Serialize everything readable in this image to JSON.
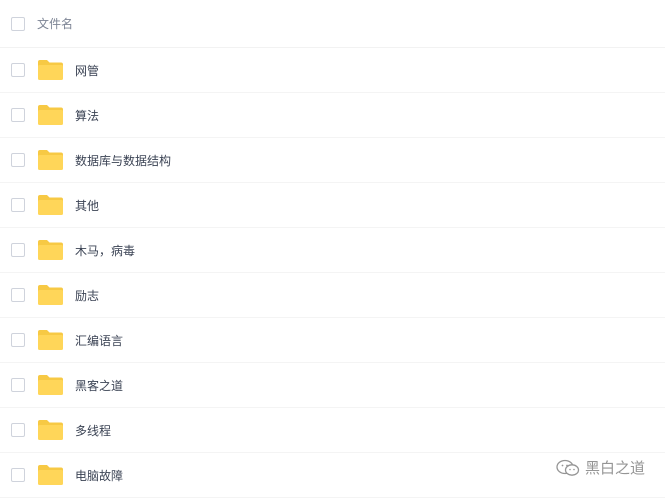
{
  "header": {
    "column_label": "文件名"
  },
  "files": [
    {
      "name": "网管",
      "icon": "folder-icon"
    },
    {
      "name": "算法",
      "icon": "folder-icon"
    },
    {
      "name": "数据库与数据结构",
      "icon": "folder-icon"
    },
    {
      "name": "其他",
      "icon": "folder-icon"
    },
    {
      "name": "木马，病毒",
      "icon": "folder-icon"
    },
    {
      "name": "励志",
      "icon": "folder-icon"
    },
    {
      "name": "汇编语言",
      "icon": "folder-icon"
    },
    {
      "name": "黑客之道",
      "icon": "folder-icon"
    },
    {
      "name": "多线程",
      "icon": "folder-icon"
    },
    {
      "name": "电脑故障",
      "icon": "folder-icon"
    }
  ],
  "watermark": {
    "text": "黑白之道",
    "icon": "wechat-icon"
  },
  "colors": {
    "folder": "#ffd659",
    "folder_tab": "#f7c944",
    "checkbox_border": "#cfd3dc",
    "divider": "#f4f4f4"
  }
}
